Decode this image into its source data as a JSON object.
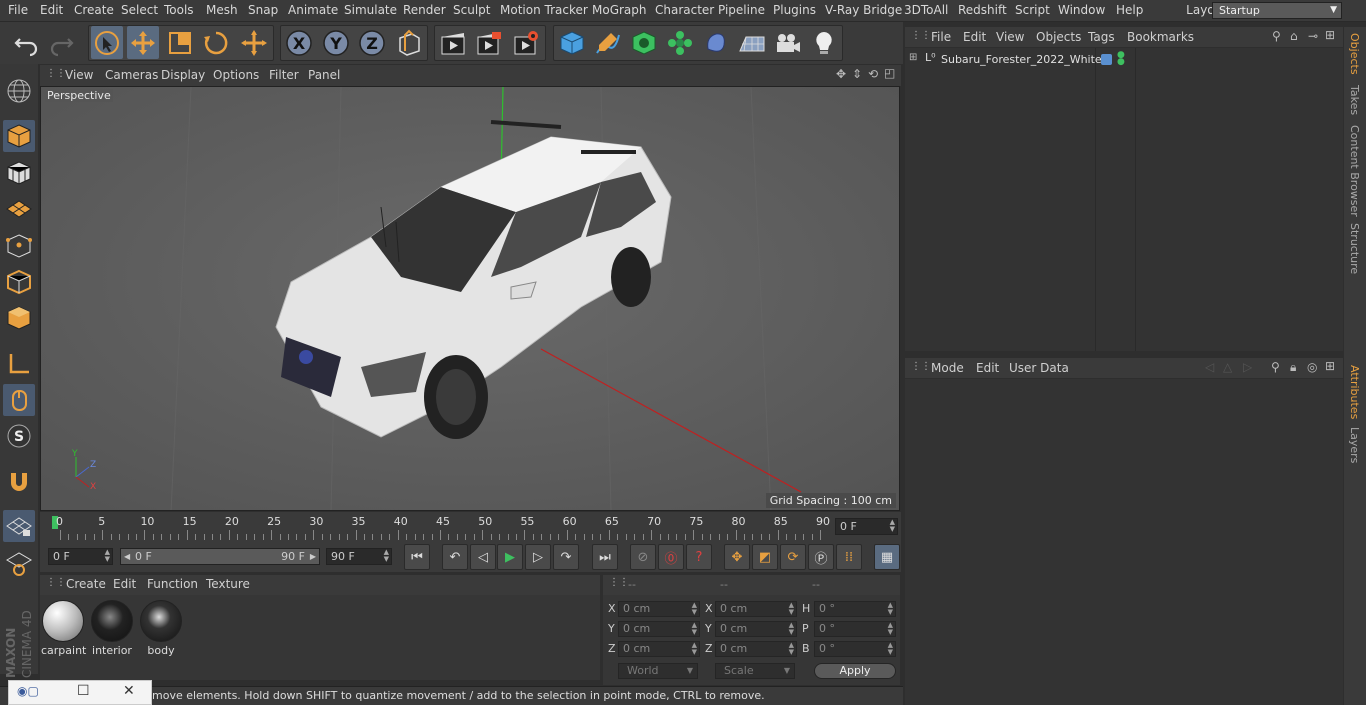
{
  "menu": [
    "File",
    "Edit",
    "Create",
    "Select",
    "Tools",
    "Mesh",
    "Snap",
    "Animate",
    "Simulate",
    "Render",
    "Sculpt",
    "Motion Tracker",
    "MoGraph",
    "Character",
    "Pipeline",
    "Plugins",
    "V-Ray Bridge",
    "3DToAll",
    "Redshift",
    "Script",
    "Window",
    "Help"
  ],
  "layout": {
    "label": "Layout:",
    "value": "Startup"
  },
  "viewport": {
    "menu": [
      "View",
      "Cameras",
      "Display",
      "Options",
      "Filter",
      "Panel"
    ],
    "camera_label": "Perspective",
    "grid_spacing": "Grid Spacing : 100 cm",
    "axis_x": "X",
    "axis_y": "Y",
    "axis_z": "Z"
  },
  "timeline": {
    "ticks": [
      "0",
      "5",
      "10",
      "15",
      "20",
      "25",
      "30",
      "35",
      "40",
      "45",
      "50",
      "55",
      "60",
      "65",
      "70",
      "75",
      "80",
      "85",
      "90"
    ],
    "current_frame": "0 F",
    "start_field": "0 F",
    "range_start": "0 F",
    "range_end": "90 F",
    "end_field": "90 F"
  },
  "materials": {
    "menu": [
      "Create",
      "Edit",
      "Function",
      "Texture"
    ],
    "items": [
      {
        "name": "carpaint"
      },
      {
        "name": "interior"
      },
      {
        "name": "body"
      }
    ]
  },
  "coordinates": {
    "headers": [
      "--",
      "--",
      "--"
    ],
    "col1": [
      {
        "label": "X",
        "value": "0 cm"
      },
      {
        "label": "Y",
        "value": "0 cm"
      },
      {
        "label": "Z",
        "value": "0 cm"
      }
    ],
    "col2": [
      {
        "label": "X",
        "value": "0 cm"
      },
      {
        "label": "Y",
        "value": "0 cm"
      },
      {
        "label": "Z",
        "value": "0 cm"
      }
    ],
    "col3": [
      {
        "label": "H",
        "value": "0 °"
      },
      {
        "label": "P",
        "value": "0 °"
      },
      {
        "label": "B",
        "value": "0 °"
      }
    ],
    "mode_world": "World",
    "mode_scale": "Scale",
    "apply": "Apply"
  },
  "objects": {
    "menu": [
      "File",
      "Edit",
      "View",
      "Objects",
      "Tags",
      "Bookmarks"
    ],
    "tree": [
      {
        "name": "Subaru_Forester_2022_White"
      }
    ]
  },
  "attributes": {
    "menu": [
      "Mode",
      "Edit",
      "User Data"
    ]
  },
  "right_tabs": [
    "Objects",
    "Takes",
    "Content Browser",
    "Structure",
    "Attributes",
    "Layers"
  ],
  "status": "move elements. Hold down SHIFT to quantize movement / add to the selection in point mode, CTRL to remove.",
  "logo": {
    "brand": "MAXON",
    "product": "CINEMA 4D"
  },
  "colors": {
    "accent": "#e8a040",
    "active_tool": "#5a6b80",
    "viewport_bg": "#5c5c5c"
  }
}
